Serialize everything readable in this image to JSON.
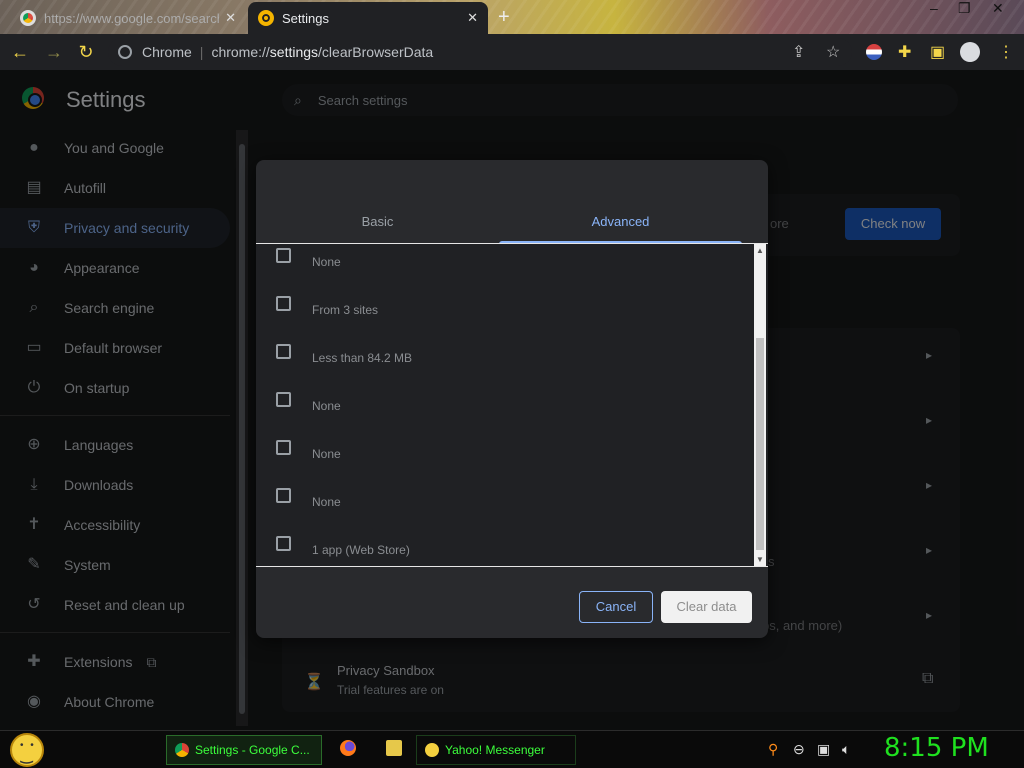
{
  "browser": {
    "tabs": [
      {
        "title": "https://www.google.com/search",
        "close": "✕"
      },
      {
        "title": "Settings",
        "close": "✕"
      }
    ],
    "new_tab": "+",
    "window_controls": {
      "minimize": "–",
      "restore": "❐",
      "close": "✕"
    },
    "omnibox": {
      "site_label": "Chrome",
      "url_prefix": "chrome://",
      "url_bold": "settings",
      "url_suffix": "/clearBrowserData"
    }
  },
  "settings": {
    "title": "Settings",
    "search_placeholder": "Search settings",
    "nav": [
      {
        "label": "You and Google",
        "icon": "person-icon"
      },
      {
        "label": "Autofill",
        "icon": "clipboard-icon"
      },
      {
        "label": "Privacy and security",
        "icon": "shield-icon",
        "active": true
      },
      {
        "label": "Appearance",
        "icon": "palette-icon"
      },
      {
        "label": "Search engine",
        "icon": "search-icon"
      },
      {
        "label": "Default browser",
        "icon": "browser-icon"
      },
      {
        "label": "On startup",
        "icon": "power-icon"
      },
      {
        "label": "Languages",
        "icon": "globe-icon"
      },
      {
        "label": "Downloads",
        "icon": "download-icon"
      },
      {
        "label": "Accessibility",
        "icon": "accessibility-icon"
      },
      {
        "label": "System",
        "icon": "wrench-icon"
      },
      {
        "label": "Reset and clean up",
        "icon": "history-icon"
      },
      {
        "label": "Extensions",
        "icon": "puzzle-icon"
      },
      {
        "label": "About Chrome",
        "icon": "chrome-icon"
      }
    ],
    "check_now": "Check now",
    "behind_text": {
      "more": "ore",
      "ps": "ps, and more)",
      "s": "s"
    },
    "privacy_sandbox": {
      "title": "Privacy Sandbox",
      "subtitle": "Trial features are on"
    }
  },
  "dialog": {
    "tabs": [
      "Basic",
      "Advanced"
    ],
    "active_tab": "Advanced",
    "items": [
      "None",
      "From 3 sites",
      "Less than 84.2 MB",
      "None",
      "None",
      "None",
      "1 app (Web Store)"
    ],
    "cancel": "Cancel",
    "clear": "Clear data"
  },
  "taskbar": {
    "tasks": [
      "Settings - Google C...",
      "Yahoo! Messenger"
    ],
    "clock": "8:15 PM"
  },
  "colors": {
    "accent": "#8ab4f8",
    "check_now": "#1a56b8",
    "clock": "#1fe01f"
  }
}
